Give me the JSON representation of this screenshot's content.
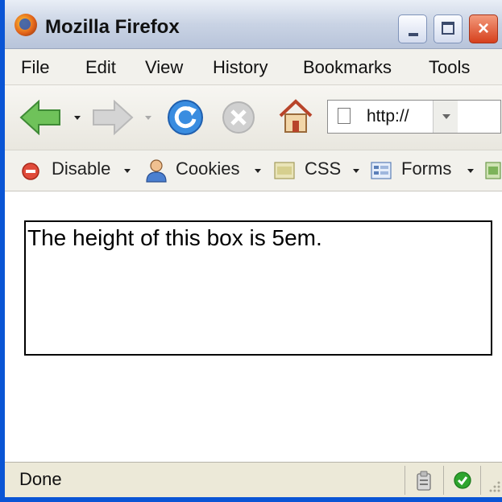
{
  "window": {
    "title": "Mozilla Firefox"
  },
  "title_buttons": {
    "minimize": "minimize",
    "maximize": "maximize",
    "close": "×"
  },
  "menu": {
    "items": [
      "File",
      "Edit",
      "View",
      "History",
      "Bookmarks",
      "Tools"
    ]
  },
  "nav": {
    "icons": [
      "back-arrow-icon",
      "forward-arrow-icon",
      "reload-icon",
      "stop-icon",
      "home-icon",
      "go-icon"
    ],
    "url": "http://"
  },
  "devbar": {
    "items": [
      "Disable",
      "Cookies",
      "CSS",
      "Forms"
    ]
  },
  "content": {
    "box_text": "The height of this box is 5em."
  },
  "status": {
    "text": "Done"
  },
  "colors": {
    "frame": "#0a55d5",
    "title_gradient_top": "#e9eef6",
    "content_bg": "#ffffff"
  }
}
